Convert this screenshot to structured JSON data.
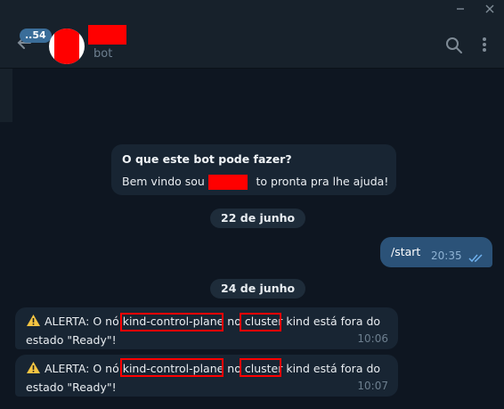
{
  "header": {
    "unread_badge": "..54",
    "subtitle": "bot"
  },
  "intro": {
    "title": "O que este bot pode fazer?",
    "text_before": "Bem vindo sou a",
    "text_after": "to pronta pra lhe ajuda!"
  },
  "dates": [
    "22 de junho",
    "24 de junho"
  ],
  "outgoing": {
    "text": "/start",
    "time": "20:35"
  },
  "alerts": [
    {
      "prefix": "ALERTA: O nó ",
      "node": "kind-control-plane",
      "mid1": " no ",
      "cluster_word": "cluster",
      "mid2": " kind está fora do",
      "line2": "estado \"Ready\"!",
      "time": "10:06"
    },
    {
      "prefix": "ALERTA: O nó ",
      "node": "kind-control-plane",
      "mid1": " no ",
      "cluster_word": "cluster",
      "mid2": " kind está fora do",
      "line2": "estado \"Ready\"!",
      "time": "10:07"
    }
  ],
  "colors": {
    "background": "#0e1621",
    "header": "#17212b",
    "incoming_bubble": "#182533",
    "outgoing_bubble": "#2b5278",
    "redaction": "#ff0000"
  },
  "icons": [
    "back-arrow-icon",
    "search-icon",
    "more-vertical-icon",
    "double-check-icon",
    "warning-icon",
    "minimize-icon",
    "close-icon"
  ]
}
